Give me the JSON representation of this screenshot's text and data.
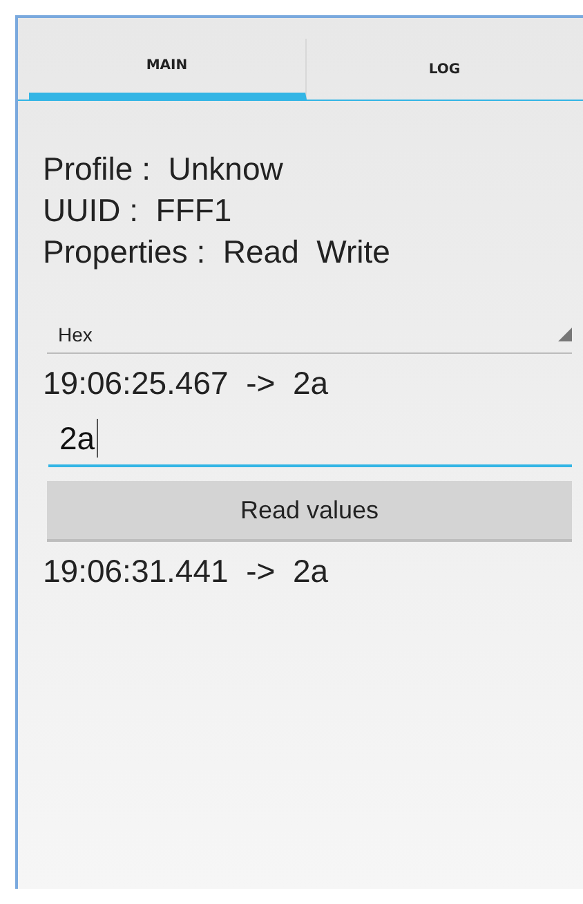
{
  "tabs": [
    {
      "label": "MAIN",
      "selected": true
    },
    {
      "label": "LOG",
      "selected": false
    }
  ],
  "info": [
    {
      "label": "Profile :",
      "value": "Unknow"
    },
    {
      "label": "UUID :",
      "value": "FFF1"
    },
    {
      "label": "Properties :",
      "value": "Read  Write"
    }
  ],
  "format_dropdown": {
    "value": "Hex"
  },
  "last_read": "19:06:25.467  ->  2a",
  "write_field": {
    "value": "2a"
  },
  "read_button": "Read values",
  "log_line": "19:06:31.441  ->  2a"
}
